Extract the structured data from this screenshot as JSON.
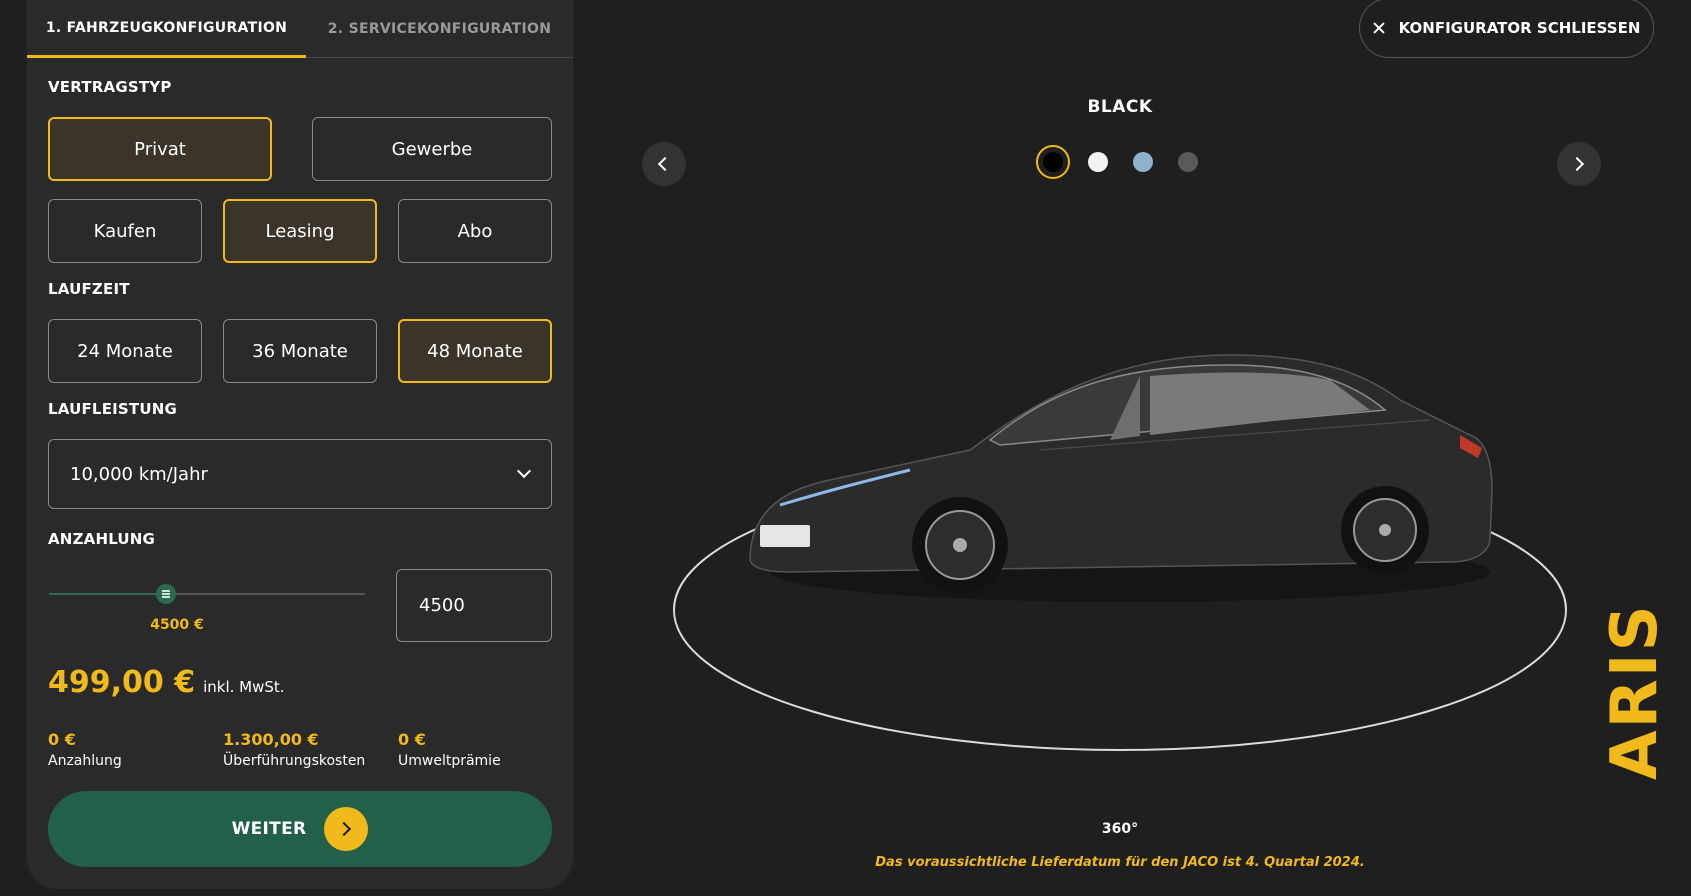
{
  "tabs": [
    {
      "label": "1. FAHRZEUGKONFIGURATION",
      "active": true
    },
    {
      "label": "2. SERVICEKONFIGURATION",
      "active": false
    }
  ],
  "vertragstyp": {
    "label": "VERTRAGSTYP",
    "customer": [
      "Privat",
      "Gewerbe"
    ],
    "customer_selected": "Privat",
    "mode": [
      "Kaufen",
      "Leasing",
      "Abo"
    ],
    "mode_selected": "Leasing"
  },
  "laufzeit": {
    "label": "LAUFZEIT",
    "options": [
      "24 Monate",
      "36 Monate",
      "48 Monate"
    ],
    "selected": "48 Monate"
  },
  "laufleistung": {
    "label": "LAUFLEISTUNG",
    "value": "10,000 km/Jahr"
  },
  "anzahlung": {
    "label": "ANZAHLUNG",
    "slider_fraction": 0.37,
    "slider_label": "4500 €",
    "input_value": "4500"
  },
  "price": {
    "main": "499,00 €",
    "note": "inkl. MwSt."
  },
  "stats": [
    {
      "value": "0 €",
      "label": "Anzahlung"
    },
    {
      "value": "1.300,00 €",
      "label": "Überführungskosten"
    },
    {
      "value": "0 €",
      "label": "Umweltprämie"
    }
  ],
  "weiter_label": "WEITER",
  "close_label": "KONFIGURATOR SCHLIESSEN",
  "color_name": "BLACK",
  "swatches": [
    {
      "color": "#000000",
      "selected": true
    },
    {
      "color": "#f2f2f2",
      "selected": false
    },
    {
      "color": "#8fb2cc",
      "selected": false
    },
    {
      "color": "#5a5a5a",
      "selected": false
    }
  ],
  "view_label": "360°",
  "delivery_note": "Das voraussichtliche Lieferdatum für den JACO ist 4. Quartal 2024.",
  "brand_text": "ARIS",
  "colors": {
    "accent": "#f0b91c",
    "cta": "#22604a",
    "panel": "#2a2a2a",
    "background": "#1f1f1f"
  }
}
